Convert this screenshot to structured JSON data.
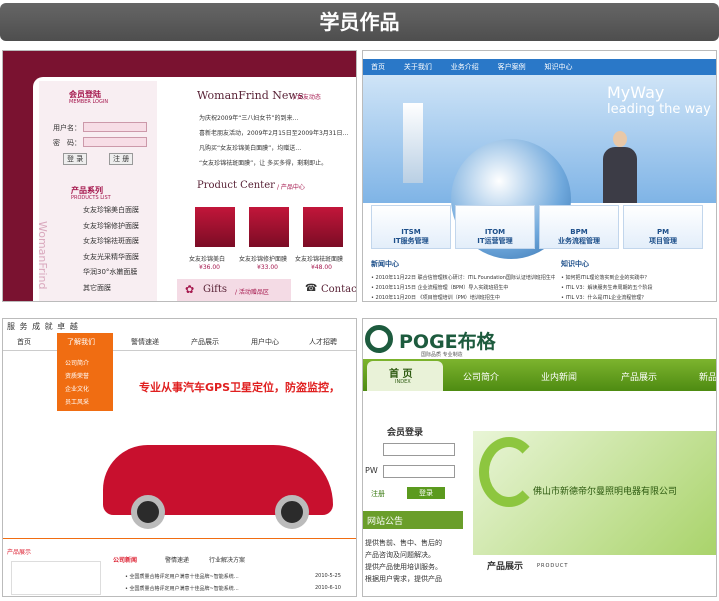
{
  "banner": {
    "title": "学员作品"
  },
  "shot1": {
    "member_title": "会员登陆",
    "member_sub": "MEMBER LOGIN",
    "user_label": "用户名：",
    "pass_label": "密　码：",
    "login_btn": "登 录",
    "register_btn": "注 册",
    "news_title": "WomanFrind News",
    "news_sub": "/ 女友动态",
    "news": [
      "为庆祝2009年“三八妇女节”的到来…",
      "喜新老朋友活动，2009年2月15日至2009年3月31日…",
      "凡购买“女友珍锦美白面膜”，均赠送…",
      "“女友珍锦祛斑面膜”，让 多买多得，剩剩即止。"
    ],
    "product_series": "产品系列",
    "product_series_sub": "PRODUCTS LIST",
    "series": [
      "女友珍锦美白面膜",
      "女友珍锦修护面膜",
      "女友珍锦祛斑面膜",
      "女友光采精华面膜",
      "华润30°水嫩面膜",
      "其它面膜"
    ],
    "brand_vertical": "WomanFrind",
    "product_center": "Product Center",
    "product_center_sub": "/ 产品中心",
    "products": [
      {
        "name": "女友珍锦美白",
        "price": "¥36.00"
      },
      {
        "name": "女友珍锦修护面膜",
        "price": "¥33.00"
      },
      {
        "name": "女友珍锦祛斑面膜",
        "price": "¥48.00"
      }
    ],
    "gifts": "Gifts",
    "gifts_sub": "/ 活动赠品区",
    "contact": "Contact"
  },
  "shot2": {
    "nav": [
      "首页",
      "关于我们",
      "业务介绍",
      "客户案例",
      "知识中心"
    ],
    "hero_title": "MyWay",
    "hero_sub": "leading the way IT",
    "tiles": [
      {
        "t": "ITSM",
        "s": "IT服务管理"
      },
      {
        "t": "ITOM",
        "s": "IT运营管理"
      },
      {
        "t": "BPM",
        "s": "业务流程管理"
      },
      {
        "t": "PM",
        "s": "项目管理"
      }
    ],
    "news_title": "新闻中心",
    "knowledge_title": "知识中心",
    "news": [
      "• 2010年11月22日 联合信管理核心研讨：ITIL Foundation国际认证培训班招生中",
      "• 2010年11月15日 企业流程管理（BPM）导入实践班招生中",
      "• 2010年11月20日 《项目管理培训（PM）培训班招生中"
    ],
    "knowledge": [
      "• 如何把ITIL理论落实到企业的实践中？",
      "• ITIL V3：解读服务生命周期的五个阶段",
      "• ITIL V3：什么是ITIL企业流程管理？"
    ],
    "colors": {
      "nav": "#2a78c8"
    }
  },
  "shot3": {
    "header": "服 务   成 就 卓 越",
    "nav": [
      "首页",
      "了解我们",
      "警情速递",
      "产品展示",
      "用户中心",
      "人才招聘"
    ],
    "dropdown": [
      "公司简介",
      "资质荣誉",
      "企业文化",
      "员工风采"
    ],
    "slogan": "专业从事汽车GPS卫星定位，防盗监控，",
    "prod_title": "产品展示",
    "news_title": "公司新闻",
    "tab2": "警情速递",
    "tab3": "行业解决方案",
    "news": [
      {
        "t": "• 全国质量合格评定用户满意十佳品牌~智能系统…",
        "d": "2010-5-25"
      },
      {
        "t": "• 全国质量合格评定用户满意十佳品牌~智能系统…",
        "d": "2010-6-10"
      }
    ]
  },
  "shot4": {
    "logo": "POGE布格",
    "logo_sub": "国际品质  专业制造",
    "nav": [
      {
        "t": "首 页",
        "s": "INDEX"
      },
      {
        "t": "公司简介"
      },
      {
        "t": "业内新闻"
      },
      {
        "t": "产品展示"
      },
      {
        "t": "新品"
      }
    ],
    "member": "会员登录",
    "pw": "PW",
    "register": "注册",
    "login": "登录",
    "notice": "网站公告",
    "notice_text": [
      "提供售前、售中、售后的",
      "产品咨询及问题解决。",
      "提供产品使用培训服务。",
      "根据用户需求，提供产品"
    ],
    "hero": "佛山市新德帝尔曼照明电器有限公司",
    "prod_title": "产品展示",
    "prod_sub": "PRODUCT"
  }
}
